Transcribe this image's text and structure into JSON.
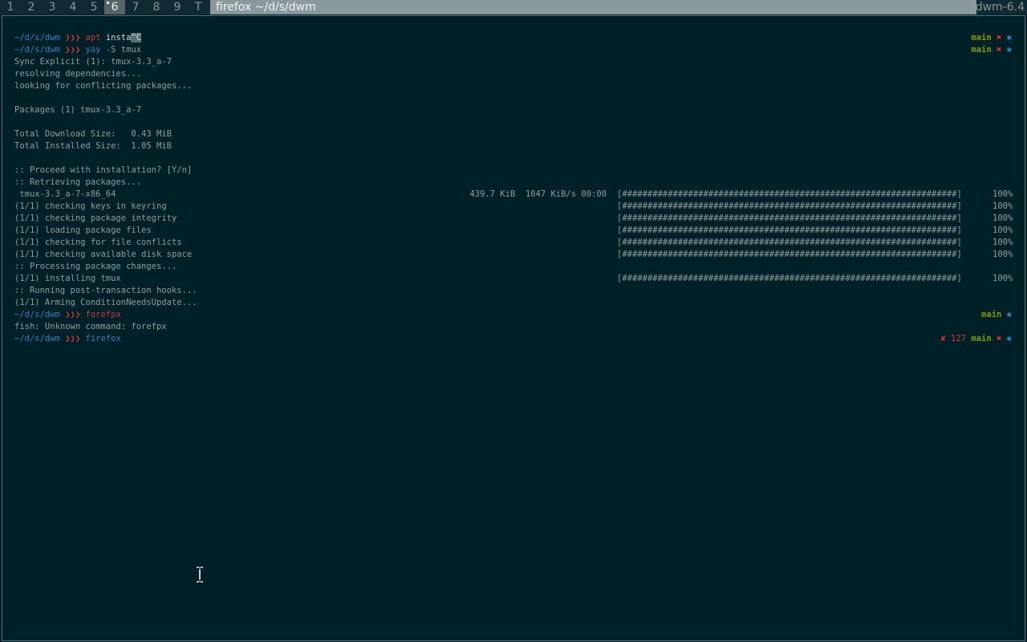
{
  "topbar": {
    "tags": [
      "1",
      "2",
      "3",
      "4",
      "5",
      "6",
      "7",
      "8",
      "9",
      "T"
    ],
    "active_tag": "6",
    "window_title": "firefox ~/d/s/dwm",
    "status": "dwm-6.4"
  },
  "terminal": {
    "prompt_path": "~/d/s/dwm",
    "prompt_arrows": "❯❯❯",
    "git_branch": "main",
    "git_dirty_icon": "✖",
    "git_icon": "✱",
    "lines": {
      "l1_cmd": "apt",
      "l1_rest": " insta",
      "l1_cursor": "^C",
      "l2_cmd": "yay",
      "l2_rest": " -S tmux",
      "l3": "Sync Explicit (1): tmux-3.3_a-7",
      "l4": "resolving dependencies...",
      "l5": "looking for conflicting packages...",
      "l6": "Packages (1) tmux-3.3_a-7",
      "l7": "Total Download Size:   0.43 MiB",
      "l8": "Total Installed Size:  1.05 MiB",
      "l9": ":: Proceed with installation? [Y/n]",
      "l10": ":: Retrieving packages...",
      "l11": " tmux-3.3_a-7-x86_64",
      "l11_stats": "439.7 KiB  1047 KiB/s 00:00",
      "l12": "(1/1) checking keys in keyring",
      "l13": "(1/1) checking package integrity",
      "l14": "(1/1) loading package files",
      "l15": "(1/1) checking for file conflicts",
      "l16": "(1/1) checking available disk space",
      "l17": ":: Processing package changes...",
      "l18": "(1/1) installing tmux",
      "l19": ":: Running post-transaction hooks...",
      "l20": "(1/1) Arming ConditionNeedsUpdate...",
      "l21_cmd": "forefpx",
      "l22": "fish: Unknown command: forefpx",
      "l23_cmd": "firefox"
    },
    "progress_bar": "[##################################################################]",
    "progress_pct": "100%",
    "exit_code": "127",
    "exit_icon": "✘"
  },
  "colors": {
    "background": "#002027",
    "prompt_path": "#2d7fc0",
    "error": "#dc322f",
    "branch": "#859900"
  }
}
